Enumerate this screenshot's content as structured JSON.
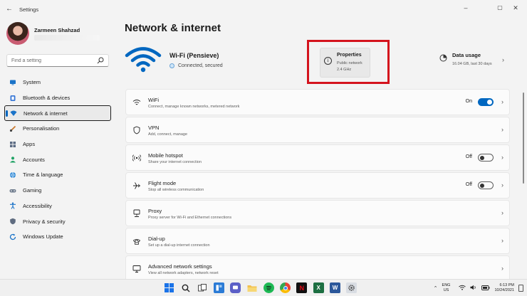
{
  "window": {
    "title": "Settings",
    "back_icon": "back-arrow-icon",
    "controls": {
      "minimize": "–",
      "maximize": "▢",
      "close": "✕"
    }
  },
  "profile": {
    "name": "Zarmeen Shahzad"
  },
  "search": {
    "placeholder": "Find a setting",
    "icon": "search-icon"
  },
  "sidebar": {
    "items": [
      {
        "label": "System",
        "icon": "system-icon",
        "active": false
      },
      {
        "label": "Bluetooth & devices",
        "icon": "bluetooth-icon",
        "active": false
      },
      {
        "label": "Network & internet",
        "icon": "network-icon",
        "active": true
      },
      {
        "label": "Personalisation",
        "icon": "brush-icon",
        "active": false
      },
      {
        "label": "Apps",
        "icon": "apps-icon",
        "active": false
      },
      {
        "label": "Accounts",
        "icon": "accounts-icon",
        "active": false
      },
      {
        "label": "Time & language",
        "icon": "globe-icon",
        "active": false
      },
      {
        "label": "Gaming",
        "icon": "gaming-icon",
        "active": false
      },
      {
        "label": "Accessibility",
        "icon": "accessibility-icon",
        "active": false
      },
      {
        "label": "Privacy & security",
        "icon": "shield-icon",
        "active": false
      },
      {
        "label": "Windows Update",
        "icon": "update-icon",
        "active": false
      }
    ]
  },
  "main": {
    "title": "Network & internet",
    "wifi": {
      "name": "Wi-Fi (Pensieve)",
      "status": "Connected, secured"
    },
    "properties": {
      "title": "Properties",
      "line1": "Public network",
      "line2": "2.4 GHz"
    },
    "data_usage": {
      "title": "Data usage",
      "detail": "16.04 GB, last 30 days"
    },
    "cards": [
      {
        "title": "WiFi",
        "subtitle": "Connect, manage known networks, metered network",
        "icon": "wifi-icon",
        "toggle": "on",
        "state_label": "On"
      },
      {
        "title": "VPN",
        "subtitle": "Add, connect, manage",
        "icon": "vpn-shield-icon",
        "toggle": null,
        "state_label": ""
      },
      {
        "title": "Mobile hotspot",
        "subtitle": "Share your internet connection",
        "icon": "hotspot-icon",
        "toggle": "off",
        "state_label": "Off"
      },
      {
        "title": "Flight mode",
        "subtitle": "Stop all wireless communication",
        "icon": "airplane-icon",
        "toggle": "off",
        "state_label": "Off"
      },
      {
        "title": "Proxy",
        "subtitle": "Proxy server for Wi-Fi and Ethernet connections",
        "icon": "proxy-icon",
        "toggle": null,
        "state_label": ""
      },
      {
        "title": "Dial-up",
        "subtitle": "Set up a dial-up internet connection",
        "icon": "phone-icon",
        "toggle": null,
        "state_label": ""
      },
      {
        "title": "Advanced network settings",
        "subtitle": "View all network adapters, network reset",
        "icon": "monitor-icon",
        "toggle": null,
        "state_label": ""
      }
    ]
  },
  "taskbar": {
    "apps": [
      {
        "name": "start-icon",
        "color": "#1a73e8"
      },
      {
        "name": "search-icon",
        "color": "#333333"
      },
      {
        "name": "task-view-icon",
        "color": "#444444"
      },
      {
        "name": "widgets-icon",
        "color": "#2b7bd6"
      },
      {
        "name": "chat-icon",
        "color": "#5b5fc7"
      },
      {
        "name": "file-explorer-icon",
        "color": "#f2c14e"
      },
      {
        "name": "spotify-icon",
        "color": "#1db954"
      },
      {
        "name": "chrome-icon",
        "color": "#e94235"
      },
      {
        "name": "netflix-icon",
        "color": "#b20710"
      },
      {
        "name": "excel-icon",
        "color": "#1d6f42"
      },
      {
        "name": "word-icon",
        "color": "#2b579a"
      },
      {
        "name": "settings-icon",
        "color": "#6b6b6b"
      }
    ],
    "lang_line1": "ENG",
    "lang_line2": "US",
    "time": "6:13 PM",
    "date": "10/24/2021"
  }
}
